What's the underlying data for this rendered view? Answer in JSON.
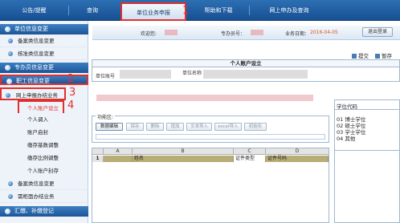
{
  "nav": {
    "tabs": [
      "公告/提醒",
      "查询",
      "单位业务申报",
      "帮助和下载",
      "网上申办及查询"
    ]
  },
  "annotations": [
    "1",
    "2",
    "3",
    "4"
  ],
  "info": {
    "welcome_label": "欢迎您:",
    "agent_label": "专办员号：",
    "date_label": "业务日期：",
    "date_value": "2016-04-05",
    "logout": "退出登录"
  },
  "sidebar": {
    "headers": [
      "单位信息变更",
      "专办员信息变更",
      "职工信息变更",
      "汇缴、补缴登记"
    ],
    "items_unit": [
      "备案类信息变更",
      "核准类信息变更"
    ],
    "online_biz": "网上申报办结业务",
    "sub_items": [
      "个人账户设立",
      "个人调入",
      "账户启封",
      "缴存基数调整",
      "缴存比例调整",
      "个人账户封存"
    ],
    "more_items": [
      "备案类信息变更",
      "需柜面办结业务"
    ]
  },
  "toolbar": {
    "submit": "提交",
    "save": "暂存"
  },
  "form": {
    "title": "个人账户设立",
    "unit_account_label": "单位账号",
    "unit_name_label": "单位名称"
  },
  "func": {
    "legend": "功能区:",
    "buttons": [
      "数据编辑",
      "保存",
      "删除",
      "增加",
      "文本导入",
      "excel导入",
      "初始化"
    ]
  },
  "grid": {
    "cols": [
      "A",
      "B",
      "C",
      "D"
    ],
    "row1": {
      "num": "1",
      "name": "姓名",
      "cert_type": "证件类型",
      "cert_no": "证件号码"
    }
  },
  "rpanel": {
    "title": "学位代码",
    "items": [
      "01  博士学位",
      "02  硕士学位",
      "03  学士学位",
      "04  其他"
    ]
  }
}
